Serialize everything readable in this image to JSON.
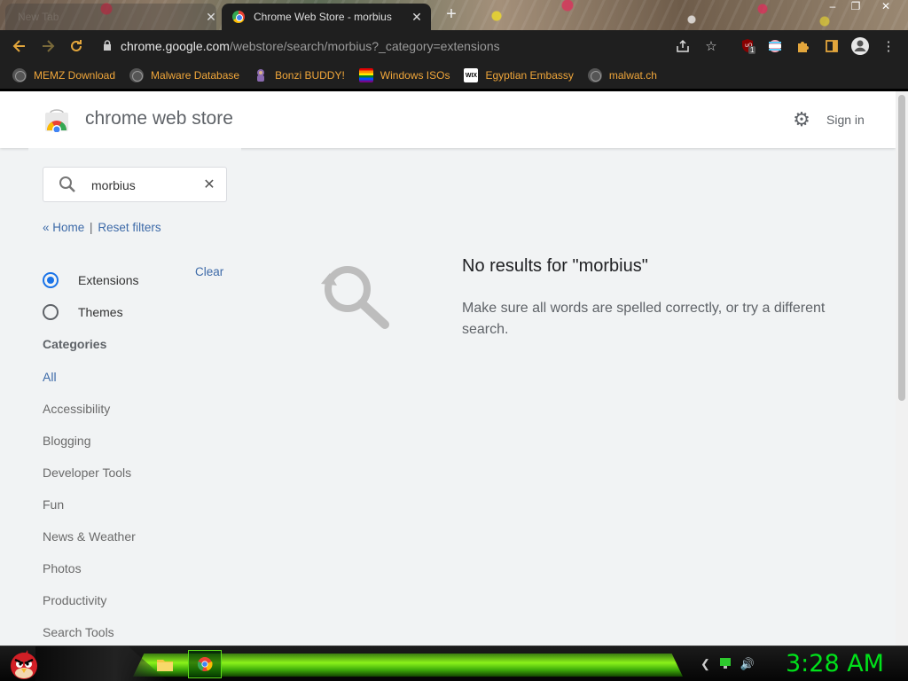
{
  "browser": {
    "tabs": [
      {
        "title": "New Tab",
        "active": false
      },
      {
        "title": "Chrome Web Store - morbius",
        "active": true
      }
    ],
    "new_tab_symbol": "+",
    "window_controls": [
      "–",
      "❐",
      "✕"
    ],
    "url": {
      "host": "chrome.google.com",
      "path": "/webstore/search/morbius?_category=extensions"
    },
    "toolbar_icons": [
      "back-icon",
      "forward-icon",
      "reload-icon",
      "lock-icon",
      "share-icon",
      "star-icon",
      "ublock-icon",
      "flag-extension-icon",
      "puzzle-icon",
      "sidepanel-icon",
      "profile-icon",
      "menu-icon"
    ],
    "ublock_badge": "1",
    "bookmarks": [
      {
        "label": "MEMZ Download",
        "icon": "globe-icon"
      },
      {
        "label": "Malware Database",
        "icon": "globe-icon"
      },
      {
        "label": "Bonzi BUDDY!",
        "icon": "bonzi-icon"
      },
      {
        "label": "Windows ISOs",
        "icon": "rainbow-flag-icon"
      },
      {
        "label": "Egyptian Embassy",
        "icon": "wix-icon"
      },
      {
        "label": "malwat.ch",
        "icon": "globe-icon"
      }
    ],
    "wix_text": "WIX"
  },
  "store": {
    "title": "chrome web store",
    "sign_in": "Sign in",
    "search": {
      "value": "morbius",
      "clear_symbol": "✕"
    },
    "home_link": "« Home",
    "link_separator": "|",
    "reset_link": "Reset filters",
    "clear_link": "Clear",
    "types": [
      {
        "label": "Extensions",
        "checked": true
      },
      {
        "label": "Themes",
        "checked": false
      }
    ],
    "categories_heading": "Categories",
    "categories": [
      "All",
      "Accessibility",
      "Blogging",
      "Developer Tools",
      "Fun",
      "News & Weather",
      "Photos",
      "Productivity",
      "Search Tools"
    ],
    "selected_category": "All",
    "no_results_title": "No results for \"morbius\"",
    "no_results_text": "Make sure all words are spelled correctly, or try a different search."
  },
  "taskbar": {
    "clock": "3:28 AM",
    "accent": "#00e11a"
  }
}
